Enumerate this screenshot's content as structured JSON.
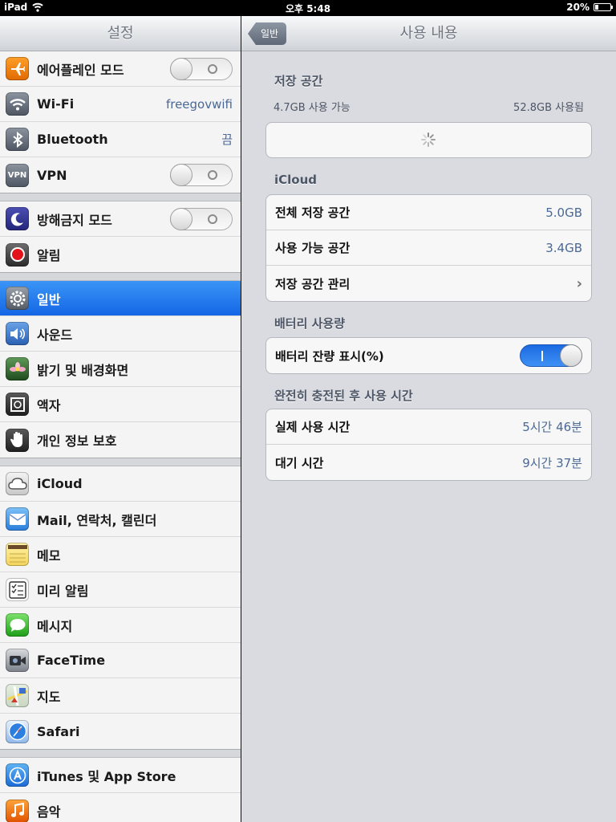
{
  "statusbar": {
    "device": "iPad",
    "time": "오후 5:48",
    "battery": "20%"
  },
  "sidebar": {
    "title": "설정",
    "groups": [
      [
        {
          "label": "에어플레인 모드",
          "icon": "airplane-icon"
        },
        {
          "label": "Wi-Fi",
          "value": "freegovwifi",
          "icon": "wifi-icon"
        },
        {
          "label": "Bluetooth",
          "value": "끔",
          "icon": "bluetooth-icon"
        },
        {
          "label": "VPN",
          "icon": "vpn-icon",
          "icon_text": "VPN"
        }
      ],
      [
        {
          "label": "방해금지 모드",
          "icon": "moon-icon"
        },
        {
          "label": "알림",
          "icon": "notifications-icon"
        }
      ],
      [
        {
          "label": "일반",
          "icon": "gear-icon"
        },
        {
          "label": "사운드",
          "icon": "speaker-icon"
        },
        {
          "label": "밝기 및 배경화면",
          "icon": "flower-icon"
        },
        {
          "label": "액자",
          "icon": "picture-frame-icon"
        },
        {
          "label": "개인 정보 보호",
          "icon": "hand-icon"
        }
      ],
      [
        {
          "label": "iCloud",
          "icon": "cloud-icon"
        },
        {
          "label": "Mail, 연락처, 캘린더",
          "icon": "mail-icon"
        },
        {
          "label": "메모",
          "icon": "notes-icon"
        },
        {
          "label": "미리 알림",
          "icon": "reminders-icon"
        },
        {
          "label": "메시지",
          "icon": "messages-icon"
        },
        {
          "label": "FaceTime",
          "icon": "facetime-icon"
        },
        {
          "label": "지도",
          "icon": "maps-icon"
        },
        {
          "label": "Safari",
          "icon": "safari-icon"
        }
      ],
      [
        {
          "label": "iTunes 및 App Store",
          "icon": "app-store-icon"
        },
        {
          "label": "음악",
          "icon": "music-icon"
        }
      ]
    ]
  },
  "detail": {
    "back_label": "일반",
    "title": "사용 내용",
    "storage": {
      "title": "저장 공간",
      "available": "4.7GB 사용 가능",
      "used": "52.8GB 사용됨"
    },
    "icloud": {
      "title": "iCloud",
      "rows": [
        {
          "label": "전체 저장 공간",
          "value": "5.0GB"
        },
        {
          "label": "사용 가능 공간",
          "value": "3.4GB"
        },
        {
          "label": "저장 공간 관리",
          "value": ""
        }
      ]
    },
    "battery": {
      "title": "배터리 사용량",
      "percent_label": "배터리 잔량 표시(%)"
    },
    "since_charge": {
      "title": "완전히 충전된 후 사용 시간",
      "rows": [
        {
          "label": "실제 사용 시간",
          "value": "5시간 46분"
        },
        {
          "label": "대기 시간",
          "value": "9시간 37분"
        }
      ]
    }
  }
}
